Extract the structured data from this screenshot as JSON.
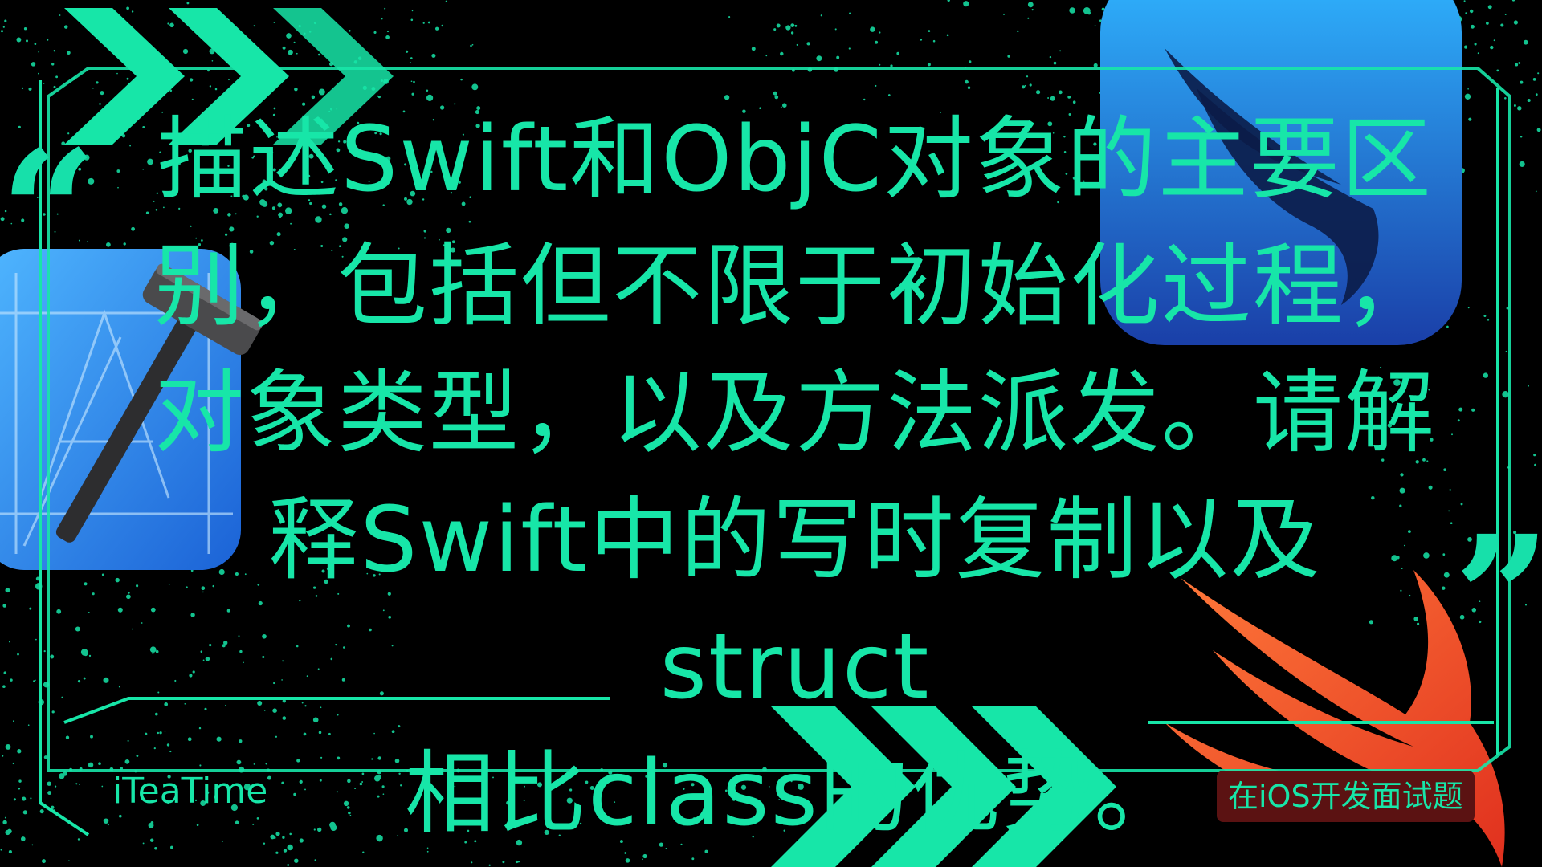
{
  "colors": {
    "accent": "#17e6a8",
    "background": "#000000",
    "badge_bg": "#5b1212",
    "swift_orange": "#f0522f"
  },
  "quote": {
    "open": "“",
    "close": "”"
  },
  "question": {
    "lines": [
      "描述Swift和ObjC对象的主要区",
      "别，包括但不限于初始化过程，",
      "对象类型，以及方法派发。请解",
      "释Swift中的写时复制以及struct",
      "相比class的优势。"
    ]
  },
  "brand": {
    "name": "iTeaTime"
  },
  "badge": {
    "label": "在iOS开发面试题"
  },
  "icons": {
    "left": "xcode-icon",
    "top_right": "swiftui-icon",
    "bottom_right": "swift-bird-icon"
  }
}
